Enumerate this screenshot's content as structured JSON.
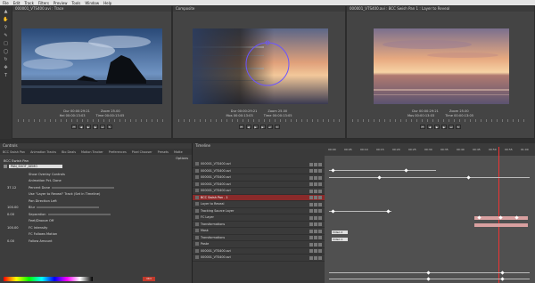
{
  "menu": [
    "File",
    "Edit",
    "Track",
    "Filters",
    "Preview",
    "Tools",
    "Window",
    "Help"
  ],
  "source": {
    "title": "000001_VTS400.avi : Trace",
    "timecode_1": "Dur 00:00:29:21",
    "timecode_2": "Hei 00:00:13:03",
    "timecode_3": "Tor 00:00:13:05",
    "timecode_4": "Time 00:00:13:05",
    "zoom": "Zoom 25.00"
  },
  "composite": {
    "title": "Composite",
    "timecode_1": "Dur 00:00:29:21",
    "timecode_2": "Mos 00:00:13:03",
    "timecode_3": "Tor 00:00:13:05",
    "timecode_4": "Time 00:00:13:05",
    "zoom": "Zoom 25.00"
  },
  "target": {
    "title": "000001_VTS400.avi : BCC Swish Pan 1 : Layer to Reveal",
    "timecode_1": "Dur 00:00:29:21",
    "timecode_2": "Mos 00:00:13:03",
    "timecode_3": "Tor 00:00:13:05",
    "timecode_4": "Time 00:00:13:05",
    "zoom": "Zoom 25.00"
  },
  "controls": {
    "title": "Controls",
    "tabs": [
      "BCC Swish Pan",
      "Animation Tracks",
      "Bio Deals",
      "Motion Tracker",
      "Preferences",
      "Pixel Chooser",
      "Presets",
      "Matte"
    ],
    "effect_name": "BCC Swish Pan",
    "preset_field": "PAN_SHOT_DEMO",
    "rows": [
      {
        "label": "Show Overlay Controls",
        "val": ""
      },
      {
        "label": "Animation  Pct. Done",
        "val": ""
      },
      {
        "label": "Percent Done",
        "val": "37.12"
      },
      {
        "label": "Use \"Layer to Reveal\" Track (Set in Timeline)",
        "val": ""
      },
      {
        "label": "Pan Direction  Left",
        "val": ""
      },
      {
        "label": "Blur",
        "val": "100.00"
      },
      {
        "label": "Separation",
        "val": "0.00"
      },
      {
        "label": "Feet/Droove  Off",
        "val": ""
      },
      {
        "label": "FC Intensity",
        "val": "100.00"
      },
      {
        "label": "FC Follows Motion",
        "val": ""
      },
      {
        "label": "Follow Amount",
        "val": "0.00"
      }
    ],
    "options_label": "Options",
    "button_label": "Ctrl"
  },
  "tracks": {
    "title": "Timeline",
    "rows": [
      {
        "label": "000001_VTS400.avi",
        "hi": false
      },
      {
        "label": "000001_VTS400.avi",
        "hi": false
      },
      {
        "label": "000001_VTS400.avi",
        "hi": false
      },
      {
        "label": "000001_VTS400.avi",
        "hi": false
      },
      {
        "label": "000001_VTS400.avi",
        "hi": false
      },
      {
        "label": "BCC Swish Pan - 1",
        "hi": true
      },
      {
        "label": "Layer to Reveal",
        "hi": false
      },
      {
        "label": "Tracking Source Layer",
        "hi": false
      },
      {
        "label": "FC Layer",
        "hi": false
      },
      {
        "label": "Transformations",
        "hi": false
      },
      {
        "label": "Mask",
        "hi": false
      },
      {
        "label": "Transformations",
        "hi": false
      },
      {
        "label": "Paste",
        "hi": false
      },
      {
        "label": "000001_VTS400.avi",
        "hi": false
      },
      {
        "label": "000001_VTS400.avi",
        "hi": false
      }
    ]
  },
  "timeline": {
    "ticks": [
      "00:00",
      "00:05",
      "00:10",
      "00:15",
      "00:20",
      "00:25",
      "00:30",
      "00:35",
      "00:40",
      "00:45",
      "00:50",
      "00:55",
      "01:00"
    ],
    "clip_labels": [
      "Video 2",
      "Video 1"
    ]
  }
}
